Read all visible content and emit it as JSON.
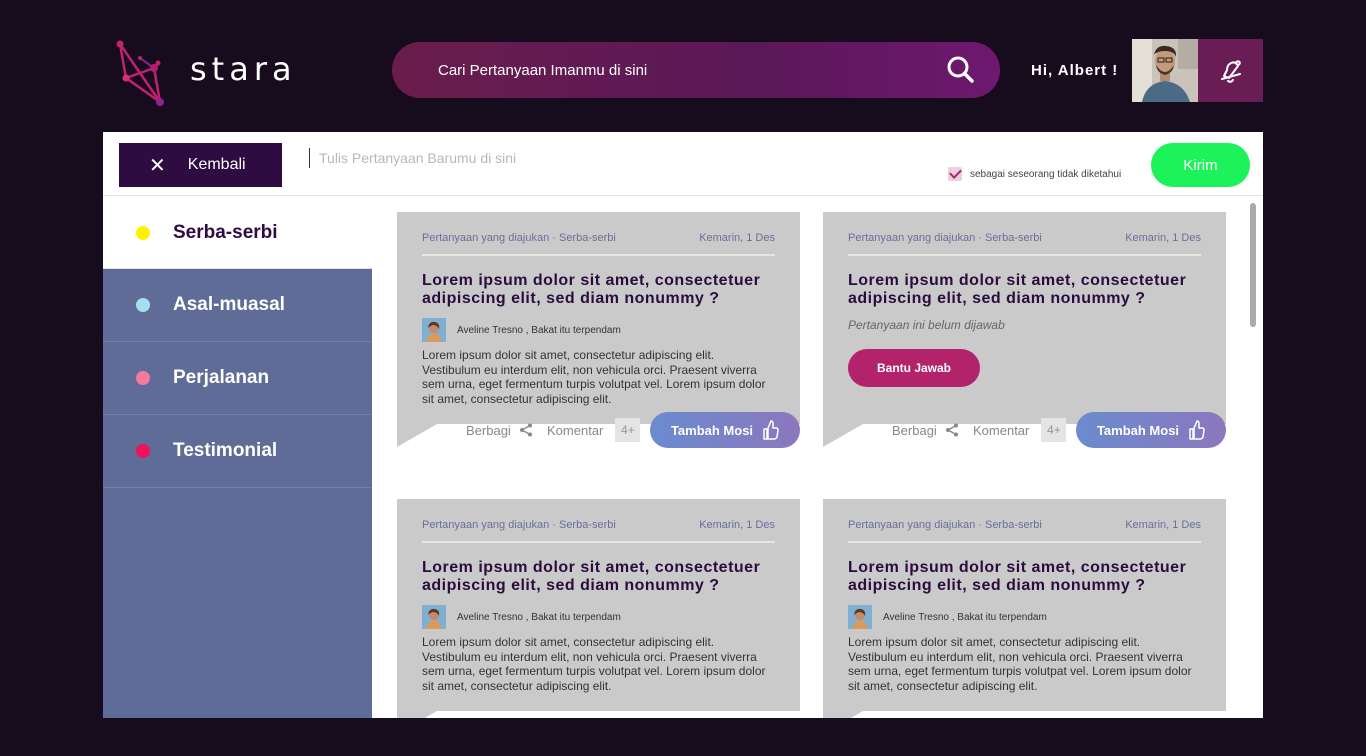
{
  "app": {
    "name": "stara"
  },
  "header": {
    "search_placeholder": "Cari Pertanyaan Imanmu di sini",
    "greeting": "Hi, Albert !"
  },
  "composer": {
    "back_label": "Kembali",
    "ask_placeholder": "Tulis Pertanyaan Barumu di sini",
    "anonymous_label": "sebagai seseorang tidak diketahui",
    "anonymous_checked": true,
    "send_label": "Kirim"
  },
  "sidebar": {
    "items": [
      {
        "label": "Serba-serbi",
        "color": "#fff200",
        "active": true
      },
      {
        "label": "Asal-muasal",
        "color": "#a6def0",
        "active": false
      },
      {
        "label": "Perjalanan",
        "color": "#f47a9c",
        "active": false
      },
      {
        "label": "Testimonial",
        "color": "#f0125a",
        "active": false
      }
    ]
  },
  "cards": [
    {
      "meta_left": "Pertanyaan yang diajukan · Serba-serbi",
      "meta_right": "Kemarin, 1 Des",
      "title": "Lorem ipsum dolor sit amet, consectetuer adipiscing elit, sed diam nonummy  ?",
      "author": "Aveline Tresno , Bakat itu terpendam",
      "answer": "Lorem ipsum dolor sit amet, consectetur adipiscing elit. Vestibulum eu interdum elit, non vehicula orci. Praesent viverra sem urna, eget fermentum turpis volutpat vel. Lorem ipsum dolor sit amet, consectetur adipiscing elit.",
      "share_label": "Berbagi",
      "comment_label": "Komentar",
      "comment_count": "4+",
      "vote_label": "Tambah Mosi"
    },
    {
      "meta_left": "Pertanyaan yang diajukan · Serba-serbi",
      "meta_right": "Kemarin, 1 Des",
      "title": "Lorem ipsum dolor sit amet, consectetuer adipiscing elit, sed diam nonummy  ?",
      "unanswered": "Pertanyaan ini belum dijawab",
      "help_label": "Bantu Jawab",
      "share_label": "Berbagi",
      "comment_label": "Komentar",
      "comment_count": "4+",
      "vote_label": "Tambah Mosi"
    },
    {
      "meta_left": "Pertanyaan yang diajukan · Serba-serbi",
      "meta_right": "Kemarin, 1 Des",
      "title": "Lorem ipsum dolor sit amet, consectetuer adipiscing elit, sed diam nonummy  ?",
      "author": "Aveline Tresno , Bakat itu terpendam",
      "answer": "Lorem ipsum dolor sit amet, consectetur adipiscing elit. Vestibulum eu interdum elit, non vehicula orci. Praesent viverra sem urna, eget fermentum turpis volutpat vel. Lorem ipsum dolor sit amet, consectetur adipiscing elit."
    },
    {
      "meta_left": "Pertanyaan yang diajukan · Serba-serbi",
      "meta_right": "Kemarin, 1 Des",
      "title": "Lorem ipsum dolor sit amet, consectetuer adipiscing elit, sed diam nonummy  ?",
      "author": "Aveline Tresno , Bakat itu terpendam",
      "answer": "Lorem ipsum dolor sit amet, consectetur adipiscing elit. Vestibulum eu interdum elit, non vehicula orci. Praesent viverra sem urna, eget fermentum turpis volutpat vel. Lorem ipsum dolor sit amet, consectetur adipiscing elit."
    }
  ],
  "icons": {
    "logo": "constellation-logo-icon",
    "search": "search-icon",
    "notify": "bell-icon",
    "close": "close-icon",
    "share": "share-icon",
    "vote": "thumbs-up-icon"
  }
}
